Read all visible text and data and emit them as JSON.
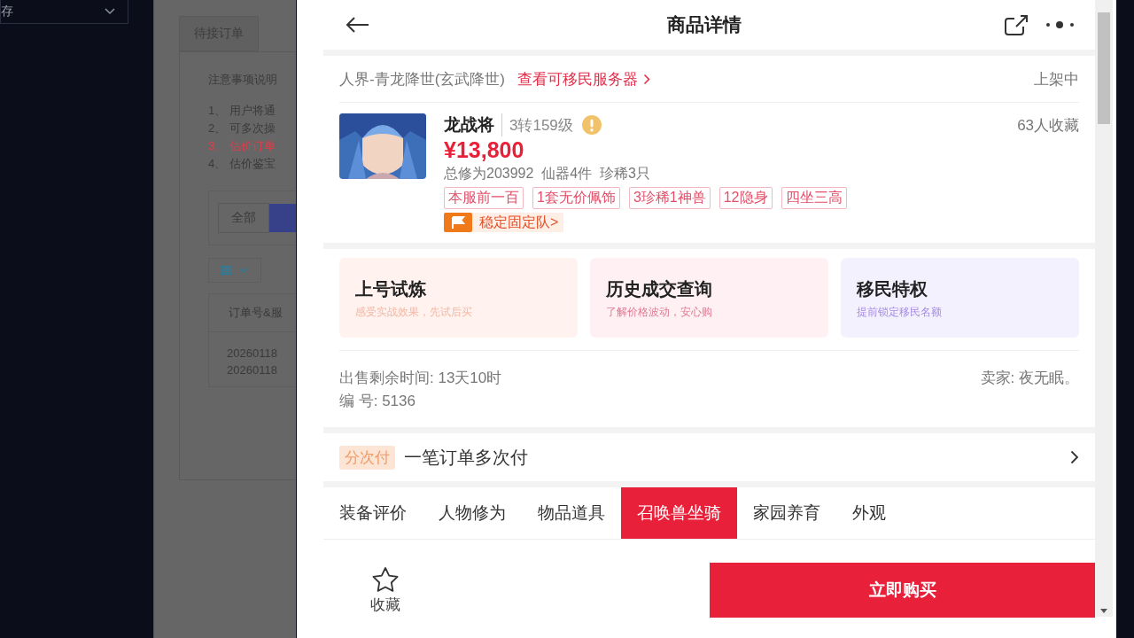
{
  "sidebar": {
    "select": "存"
  },
  "background_page": {
    "tabs": [
      {
        "label": "待接订单",
        "selected": false
      }
    ],
    "notice_title": "注意事项说明",
    "notice_items": [
      {
        "text": "1、 用户将通",
        "kind": "normal"
      },
      {
        "text": "2、 可多次操",
        "kind": "normal"
      },
      {
        "text": "3、 估价订单",
        "kind": "warning"
      },
      {
        "text": "4、 估价鉴宝",
        "kind": "normal"
      }
    ],
    "filter": "全部",
    "table": {
      "column": "订单号&服",
      "rows": [
        "20260118",
        "20260118"
      ]
    }
  },
  "detail": {
    "title": "商品详情",
    "server": "人界-青龙降世(玄武降世)",
    "server_link": "查看可移民服务器",
    "status": "上架中",
    "item": {
      "name": "龙战将",
      "level": "3转159级",
      "price": "¥13,800",
      "favorites": "63人收藏",
      "stats": "总修为203992  仙器4件  珍稀3只",
      "tags": [
        "本服前一百",
        "1套无价佩饰",
        "3珍稀1神兽",
        "12隐身",
        "四坐三高"
      ],
      "team_badge": "稳定固定队>"
    },
    "cards": [
      {
        "title": "上号试炼",
        "subtitle": "感受实战效果，先试后买",
        "kind": "trial"
      },
      {
        "title": "历史成交查询",
        "subtitle": "了解价格波动，安心购",
        "kind": "history"
      },
      {
        "title": "移民特权",
        "subtitle": "提前锁定移民名额",
        "kind": "migrate"
      }
    ],
    "sale_time": "出售剩余时间: 13天10时",
    "seller": "卖家: 夜无眠。",
    "number": "编 号: 5136",
    "installment": {
      "tag": "分次付",
      "text": "一笔订单多次付"
    },
    "tabs": [
      {
        "label": "装备评价",
        "selected": false
      },
      {
        "label": "人物修为",
        "selected": false
      },
      {
        "label": "物品道具",
        "selected": false
      },
      {
        "label": "召唤兽坐骑",
        "selected": true
      },
      {
        "label": "家园养育",
        "selected": false
      },
      {
        "label": "外观",
        "selected": false
      }
    ],
    "favorite_label": "收藏",
    "buy_button": "立即购买"
  }
}
